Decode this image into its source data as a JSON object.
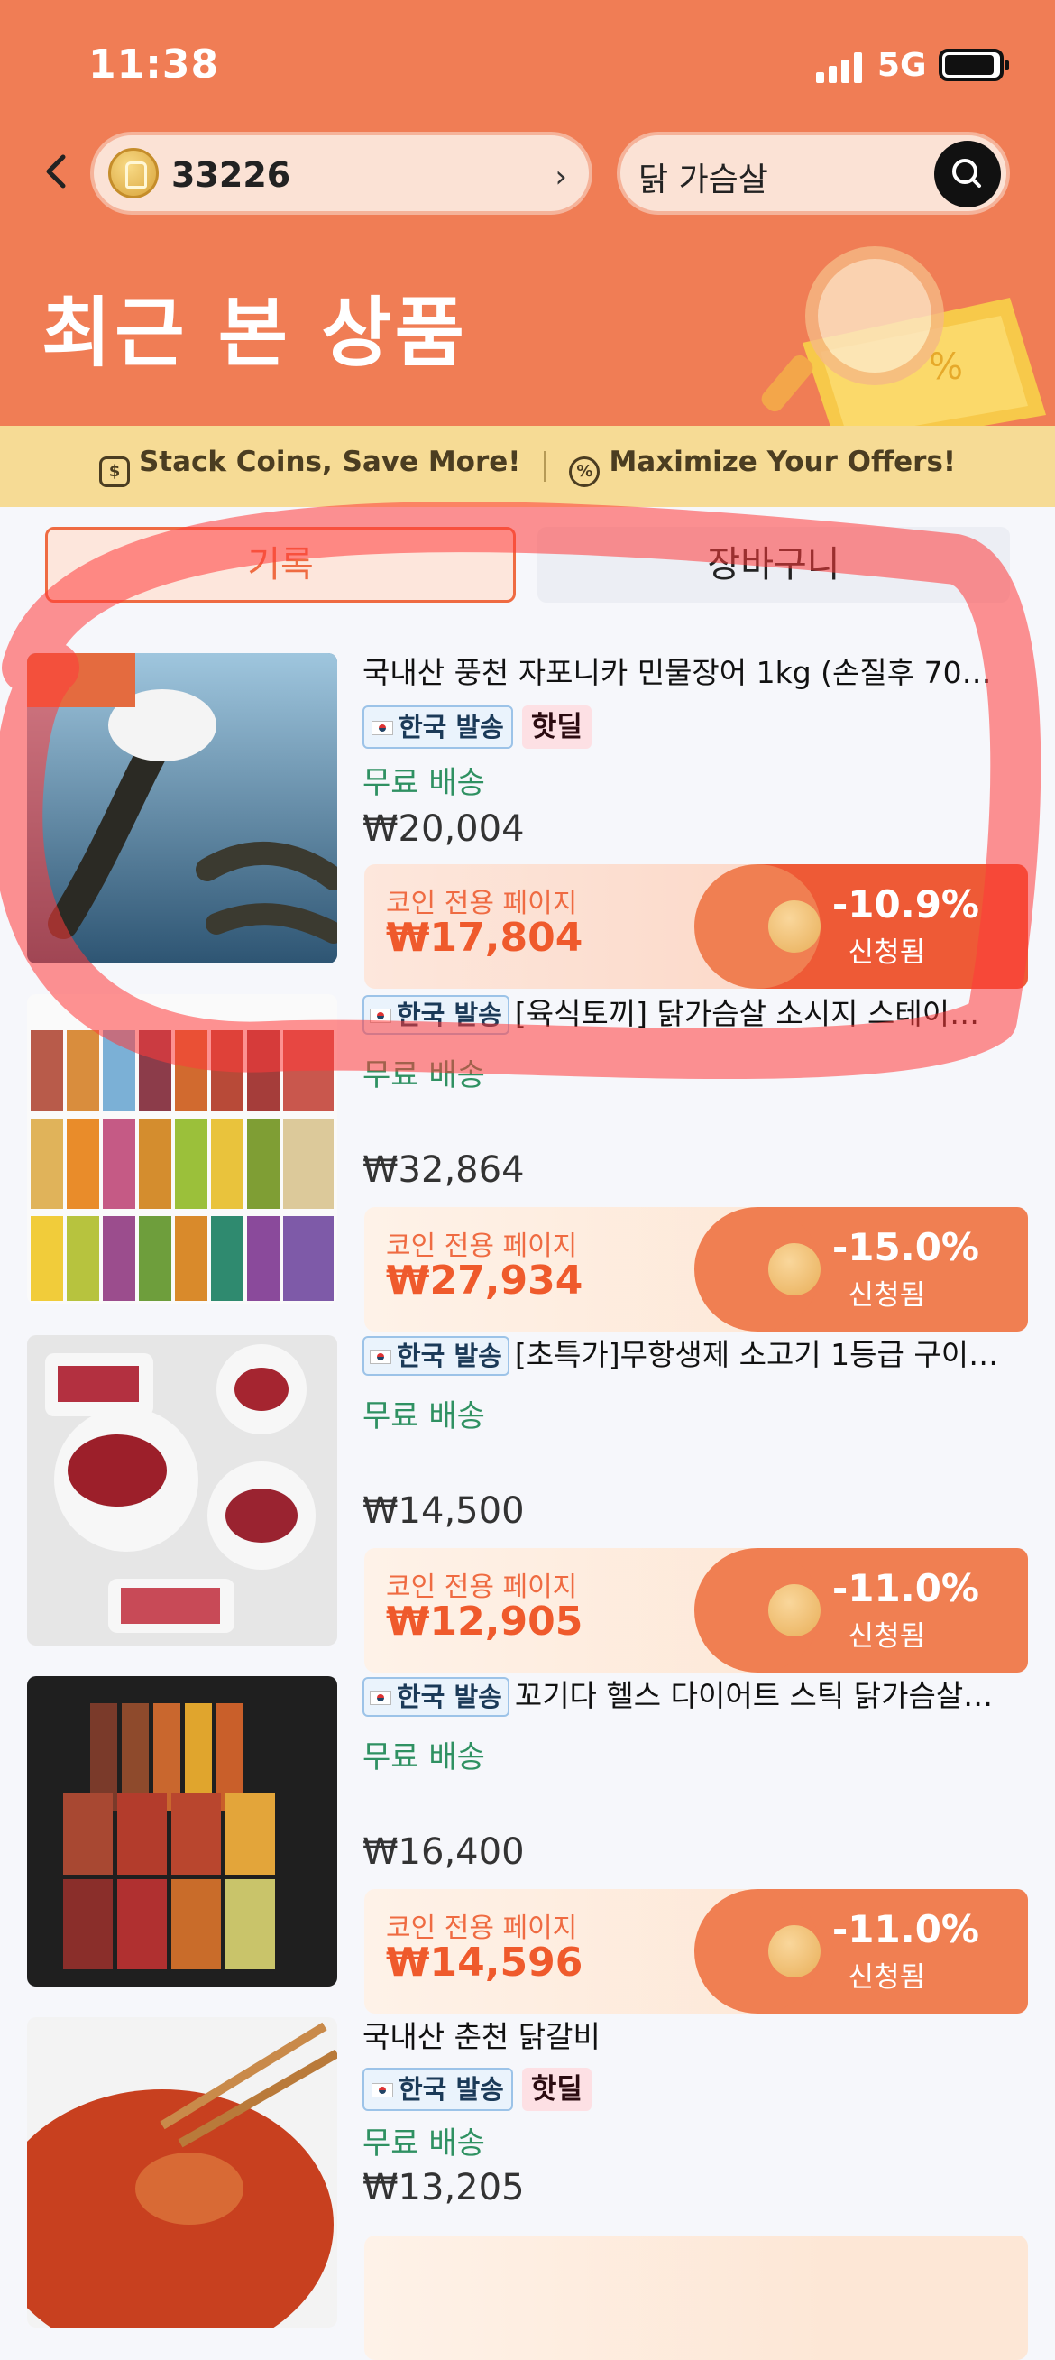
{
  "status_bar": {
    "time": "11:38",
    "network": "5G"
  },
  "header": {
    "coin_balance": "33226",
    "search_query": "닭 가슴살",
    "title": "최근 본 상품"
  },
  "banner": {
    "left": "Stack Coins, Save More!",
    "right": "Maximize Your Offers!"
  },
  "tabs": {
    "history": "기록",
    "cart": "장바구니"
  },
  "colors": {
    "accent": "#f07d55",
    "free_shipping": "#2f9162",
    "offer_text": "#ef5a2c"
  },
  "items": [
    {
      "title": "국내산 풍천 자포니카 민물장어 1kg (손질후 70…",
      "origin_badge": "한국 발송",
      "hot_badge": "핫딜",
      "shipping": "무료 배송",
      "price": "₩20,004",
      "offer_label": "코인 전용 페이지",
      "offer_price": "₩17,804",
      "discount": "-10.9%",
      "status": "신청됨"
    },
    {
      "title": "[육식토끼] 닭가슴살 소시지 스테이…",
      "origin_badge": "한국 발송",
      "shipping": "무료 배송",
      "price": "₩32,864",
      "offer_label": "코인 전용 페이지",
      "offer_price": "₩27,934",
      "discount": "-15.0%",
      "status": "신청됨"
    },
    {
      "title": "[초특가]무항생제 소고기 1등급 구이…",
      "origin_badge": "한국 발송",
      "shipping": "무료 배송",
      "price": "₩14,500",
      "offer_label": "코인 전용 페이지",
      "offer_price": "₩12,905",
      "discount": "-11.0%",
      "status": "신청됨"
    },
    {
      "title": "꼬기다 헬스 다이어트 스틱 닭가슴살…",
      "origin_badge": "한국 발송",
      "shipping": "무료 배송",
      "price": "₩16,400",
      "offer_label": "코인 전용 페이지",
      "offer_price": "₩14,596",
      "discount": "-11.0%",
      "status": "신청됨"
    },
    {
      "title": "국내산 춘천 닭갈비",
      "origin_badge": "한국 발송",
      "hot_badge": "핫딜",
      "shipping": "무료 배송",
      "price": "₩13,205"
    }
  ]
}
